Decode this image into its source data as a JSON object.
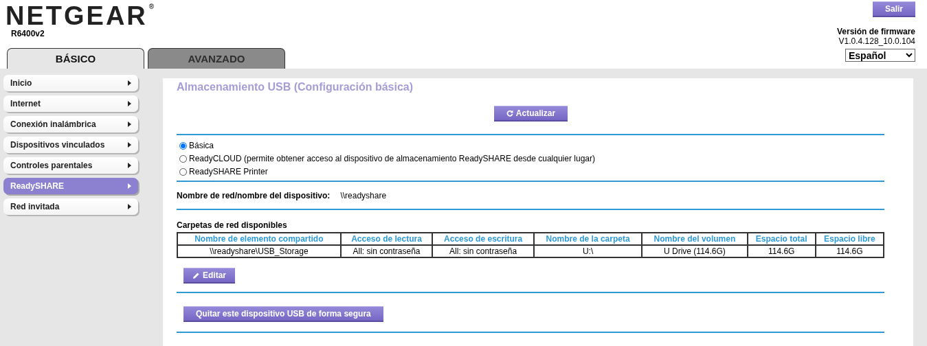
{
  "header": {
    "logo": "NETGEAR",
    "logo_mark": "®",
    "model": "R6400v2",
    "logout": "Salir",
    "firmware_label": "Versión de firmware",
    "firmware_version": "V1.0.4.128_10.0.104",
    "language": "Español"
  },
  "tabs": [
    {
      "label": "BÁSICO",
      "selected": true
    },
    {
      "label": "AVANZADO",
      "selected": false
    }
  ],
  "sidebar": {
    "items": [
      {
        "label": "Inicio",
        "selected": false
      },
      {
        "label": "Internet",
        "selected": false
      },
      {
        "label": "Conexión inalámbrica",
        "selected": false
      },
      {
        "label": "Dispositivos vinculados",
        "selected": false
      },
      {
        "label": "Controles parentales",
        "selected": false
      },
      {
        "label": "ReadySHARE",
        "selected": true
      },
      {
        "label": "Red invitada",
        "selected": false
      }
    ]
  },
  "content": {
    "title": "Almacenamiento USB (Configuración básica)",
    "refresh_button": "Actualizar",
    "modes": [
      {
        "label": "Básica",
        "selected": true
      },
      {
        "label": "ReadyCLOUD (permite obtener acceso al dispositivo de almacenamiento ReadySHARE desde cualquier lugar)",
        "selected": false
      },
      {
        "label": "ReadySHARE Printer",
        "selected": false
      }
    ],
    "device_name_label": "Nombre de red/nombre del dispositivo:",
    "device_name": "\\\\readyshare",
    "table": {
      "title": "Carpetas de red disponibles",
      "columns": [
        "Nombre de elemento compartido",
        "Acceso de lectura",
        "Acceso de escritura",
        "Nombre de la carpeta",
        "Nombre del volumen",
        "Espacio total",
        "Espacio libre"
      ],
      "rows": [
        [
          "\\\\readyshare\\USB_Storage",
          "All: sin contraseña",
          "All: sin contraseña",
          "U:\\",
          "U Drive (114.6G)",
          "114.6G",
          "114.6G"
        ]
      ]
    },
    "edit_button": "Editar",
    "eject_button": "Quitar este dispositivo USB de forma segura"
  }
}
